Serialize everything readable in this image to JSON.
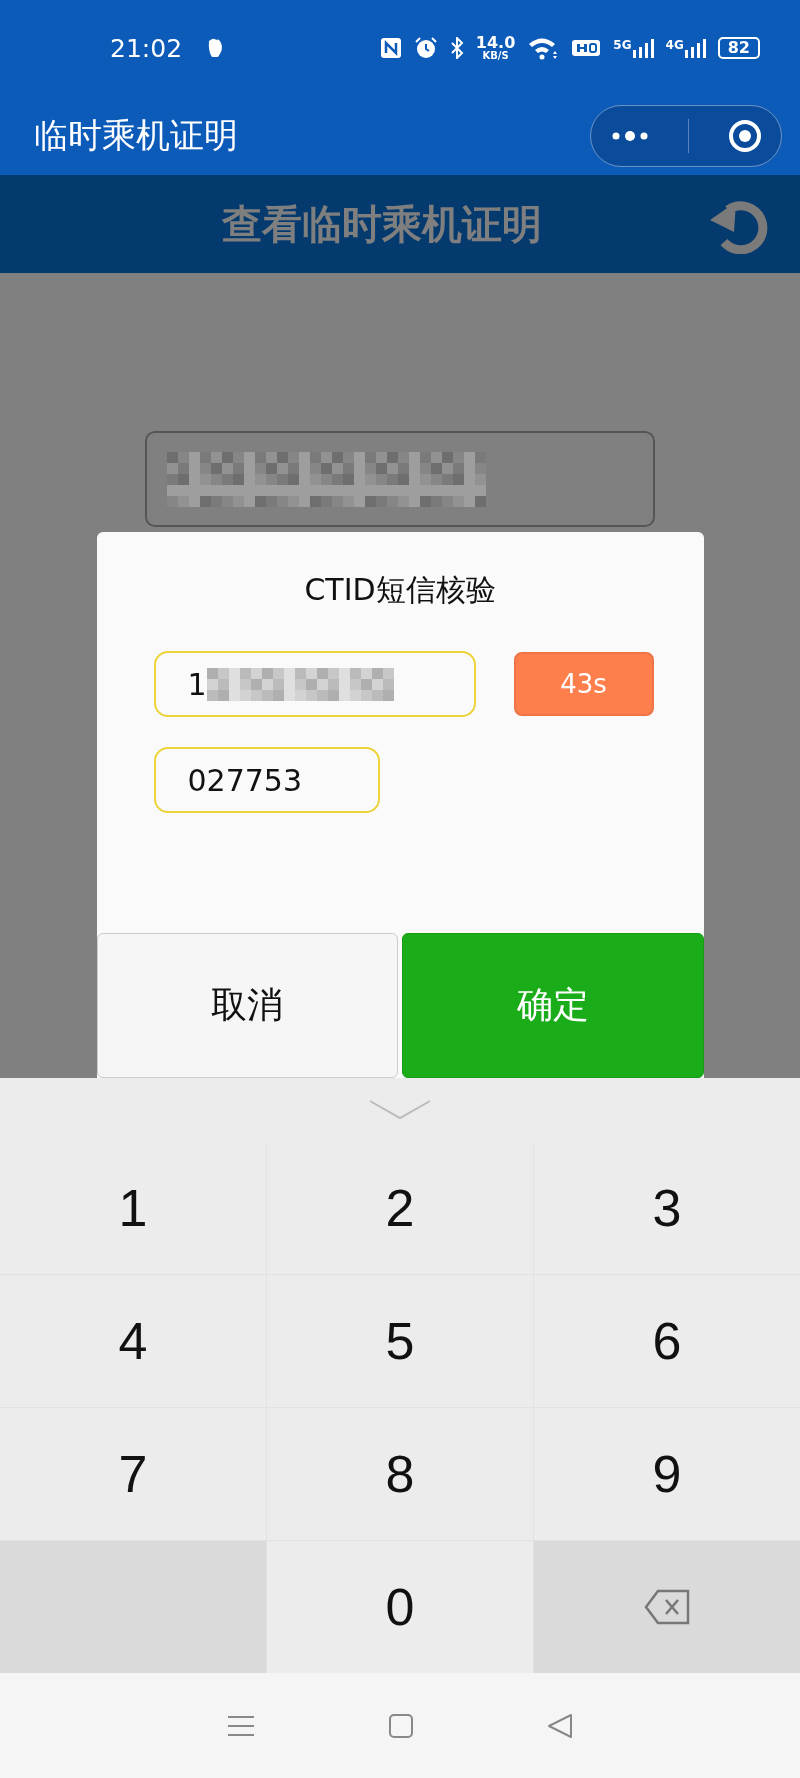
{
  "status_bar": {
    "time": "21:02",
    "speed_value": "14.0",
    "speed_unit": "KB/S",
    "signals": [
      {
        "label": "5G"
      },
      {
        "label": "4G"
      }
    ],
    "battery": "82"
  },
  "app_bar": {
    "title": "临时乘机证明"
  },
  "page_header": {
    "title": "查看临时乘机证明"
  },
  "dialog": {
    "title": "CTID短信核验",
    "phone_field": {
      "value": "1"
    },
    "countdown_button": {
      "label": "43s"
    },
    "code_field": {
      "value": "027753"
    },
    "buttons": [
      {
        "label": "取消",
        "kind": "cancel"
      },
      {
        "label": "确定",
        "kind": "confirm"
      }
    ]
  },
  "keypad": {
    "keys": [
      {
        "kind": "digit",
        "label": "1"
      },
      {
        "kind": "digit",
        "label": "2"
      },
      {
        "kind": "digit",
        "label": "3"
      },
      {
        "kind": "digit",
        "label": "4"
      },
      {
        "kind": "digit",
        "label": "5"
      },
      {
        "kind": "digit",
        "label": "6"
      },
      {
        "kind": "digit",
        "label": "7"
      },
      {
        "kind": "digit",
        "label": "8"
      },
      {
        "kind": "digit",
        "label": "9"
      },
      {
        "kind": "blank"
      },
      {
        "kind": "digit",
        "label": "0"
      },
      {
        "kind": "backspace"
      }
    ]
  }
}
